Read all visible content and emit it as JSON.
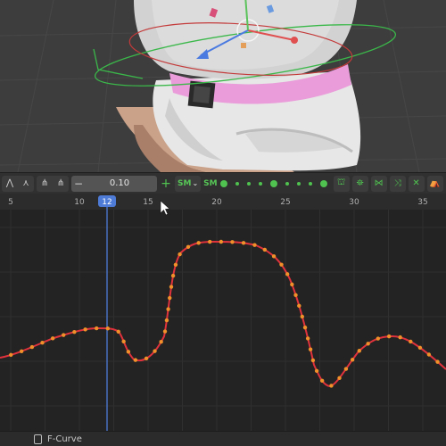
{
  "toolbar": {
    "step_value": "0.10",
    "minus": "−",
    "plus": "+",
    "sm_label": "SM",
    "sm_alt": "SM"
  },
  "timeline": {
    "ticks": [
      "5",
      "10",
      "12",
      "15",
      "20",
      "25",
      "30",
      "35"
    ],
    "current_frame": "12"
  },
  "status": {
    "label": "F-Curve"
  },
  "colors": {
    "curve": "#e0323c",
    "key": "#f0902a",
    "playhead": "#4d7bd6",
    "background": "#232323"
  },
  "icons": [
    "keyframe-handle-icon",
    "interpolation-icon",
    "minus-icon",
    "plus-icon",
    "ghost-icon",
    "normalize-icon",
    "snap-icon",
    "mirror-icon",
    "delete-icon",
    "bake-icon"
  ]
}
